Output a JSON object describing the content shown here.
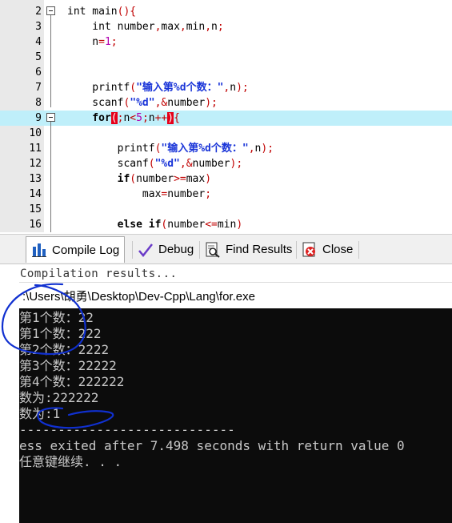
{
  "editor": {
    "lines": [
      {
        "num": "2",
        "segments": [
          {
            "t": "int",
            "c": "kw2"
          },
          {
            "t": " main",
            "c": ""
          },
          {
            "t": "(){",
            "c": "sym"
          }
        ]
      },
      {
        "num": "3",
        "segments": [
          {
            "t": "    int",
            "c": "kw2"
          },
          {
            "t": " number",
            "c": ""
          },
          {
            "t": ",",
            "c": "sym"
          },
          {
            "t": "max",
            "c": ""
          },
          {
            "t": ",",
            "c": "sym"
          },
          {
            "t": "min",
            "c": ""
          },
          {
            "t": ",",
            "c": "sym"
          },
          {
            "t": "n",
            "c": ""
          },
          {
            "t": ";",
            "c": "sym"
          }
        ]
      },
      {
        "num": "4",
        "segments": [
          {
            "t": "    n",
            "c": ""
          },
          {
            "t": "=",
            "c": "sym"
          },
          {
            "t": "1",
            "c": "num"
          },
          {
            "t": ";",
            "c": "sym"
          }
        ]
      },
      {
        "num": "5",
        "segments": []
      },
      {
        "num": "6",
        "segments": []
      },
      {
        "num": "7",
        "segments": [
          {
            "t": "    printf",
            "c": ""
          },
          {
            "t": "(",
            "c": "sym"
          },
          {
            "t": "\"输入第%d个数：\"",
            "c": "str"
          },
          {
            "t": ",",
            "c": "sym"
          },
          {
            "t": "n",
            "c": ""
          },
          {
            "t": ");",
            "c": "sym"
          }
        ]
      },
      {
        "num": "8",
        "segments": [
          {
            "t": "    scanf",
            "c": ""
          },
          {
            "t": "(",
            "c": "sym"
          },
          {
            "t": "\"%d\"",
            "c": "str"
          },
          {
            "t": ",&",
            "c": "sym"
          },
          {
            "t": "number",
            "c": ""
          },
          {
            "t": ");",
            "c": "sym"
          }
        ]
      },
      {
        "num": "9",
        "segments": [
          {
            "t": "    for",
            "c": "kwb"
          },
          {
            "t": "(",
            "c": "brk"
          },
          {
            "t": ";",
            "c": "sym"
          },
          {
            "t": "n",
            "c": ""
          },
          {
            "t": "<",
            "c": "sym"
          },
          {
            "t": "5",
            "c": "num"
          },
          {
            "t": ";",
            "c": "sym"
          },
          {
            "t": "n",
            "c": ""
          },
          {
            "t": "++",
            "c": "sym"
          },
          {
            "t": ")",
            "c": "brk"
          },
          {
            "t": "{",
            "c": "sym"
          }
        ]
      },
      {
        "num": "10",
        "segments": []
      },
      {
        "num": "11",
        "segments": [
          {
            "t": "        printf",
            "c": ""
          },
          {
            "t": "(",
            "c": "sym"
          },
          {
            "t": "\"输入第%d个数：\"",
            "c": "str"
          },
          {
            "t": ",",
            "c": "sym"
          },
          {
            "t": "n",
            "c": ""
          },
          {
            "t": ");",
            "c": "sym"
          }
        ]
      },
      {
        "num": "12",
        "segments": [
          {
            "t": "        scanf",
            "c": ""
          },
          {
            "t": "(",
            "c": "sym"
          },
          {
            "t": "\"%d\"",
            "c": "str"
          },
          {
            "t": ",&",
            "c": "sym"
          },
          {
            "t": "number",
            "c": ""
          },
          {
            "t": ");",
            "c": "sym"
          }
        ]
      },
      {
        "num": "13",
        "segments": [
          {
            "t": "        if",
            "c": "kwb"
          },
          {
            "t": "(",
            "c": "sym"
          },
          {
            "t": "number",
            "c": ""
          },
          {
            "t": ">=",
            "c": "sym"
          },
          {
            "t": "max",
            "c": ""
          },
          {
            "t": ")",
            "c": "sym"
          }
        ]
      },
      {
        "num": "14",
        "segments": [
          {
            "t": "            max",
            "c": ""
          },
          {
            "t": "=",
            "c": "sym"
          },
          {
            "t": "number",
            "c": ""
          },
          {
            "t": ";",
            "c": "sym"
          }
        ]
      },
      {
        "num": "15",
        "segments": []
      },
      {
        "num": "16",
        "segments": [
          {
            "t": "        else",
            "c": "kwb"
          },
          {
            "t": " if",
            "c": "kwb"
          },
          {
            "t": "(",
            "c": "sym"
          },
          {
            "t": "number",
            "c": ""
          },
          {
            "t": "<=",
            "c": "sym"
          },
          {
            "t": "min",
            "c": ""
          },
          {
            "t": ")",
            "c": "sym"
          }
        ]
      }
    ]
  },
  "tabs": [
    {
      "label": "Compile Log",
      "icon": "bar-chart-icon",
      "active": true
    },
    {
      "label": "Debug",
      "icon": "checkmark-icon",
      "active": false
    },
    {
      "label": "Find Results",
      "icon": "find-results-icon",
      "active": false
    },
    {
      "label": "Close",
      "icon": "close-icon",
      "active": false
    }
  ],
  "compile_log_text": "Compilation results...",
  "console": {
    "title": ":\\Users\\胡勇\\Desktop\\Dev-Cpp\\Lang\\for.exe",
    "lines": [
      "第1个数：22",
      "第1个数：222",
      "第2个数：2222",
      "第3个数：22222",
      "第4个数：222222",
      "数为:222222",
      "数为:1",
      "----------------------------",
      "ess exited after 7.498 seconds with return value 0",
      "任意键继续. . ."
    ]
  },
  "colors": {
    "highlight_line": "#bfeffa",
    "string": "#1a35d8",
    "symbol": "#c00000",
    "bracket_match": "#e6001a",
    "console_bg": "#0c0c0c",
    "annotation": "#1030d0"
  }
}
